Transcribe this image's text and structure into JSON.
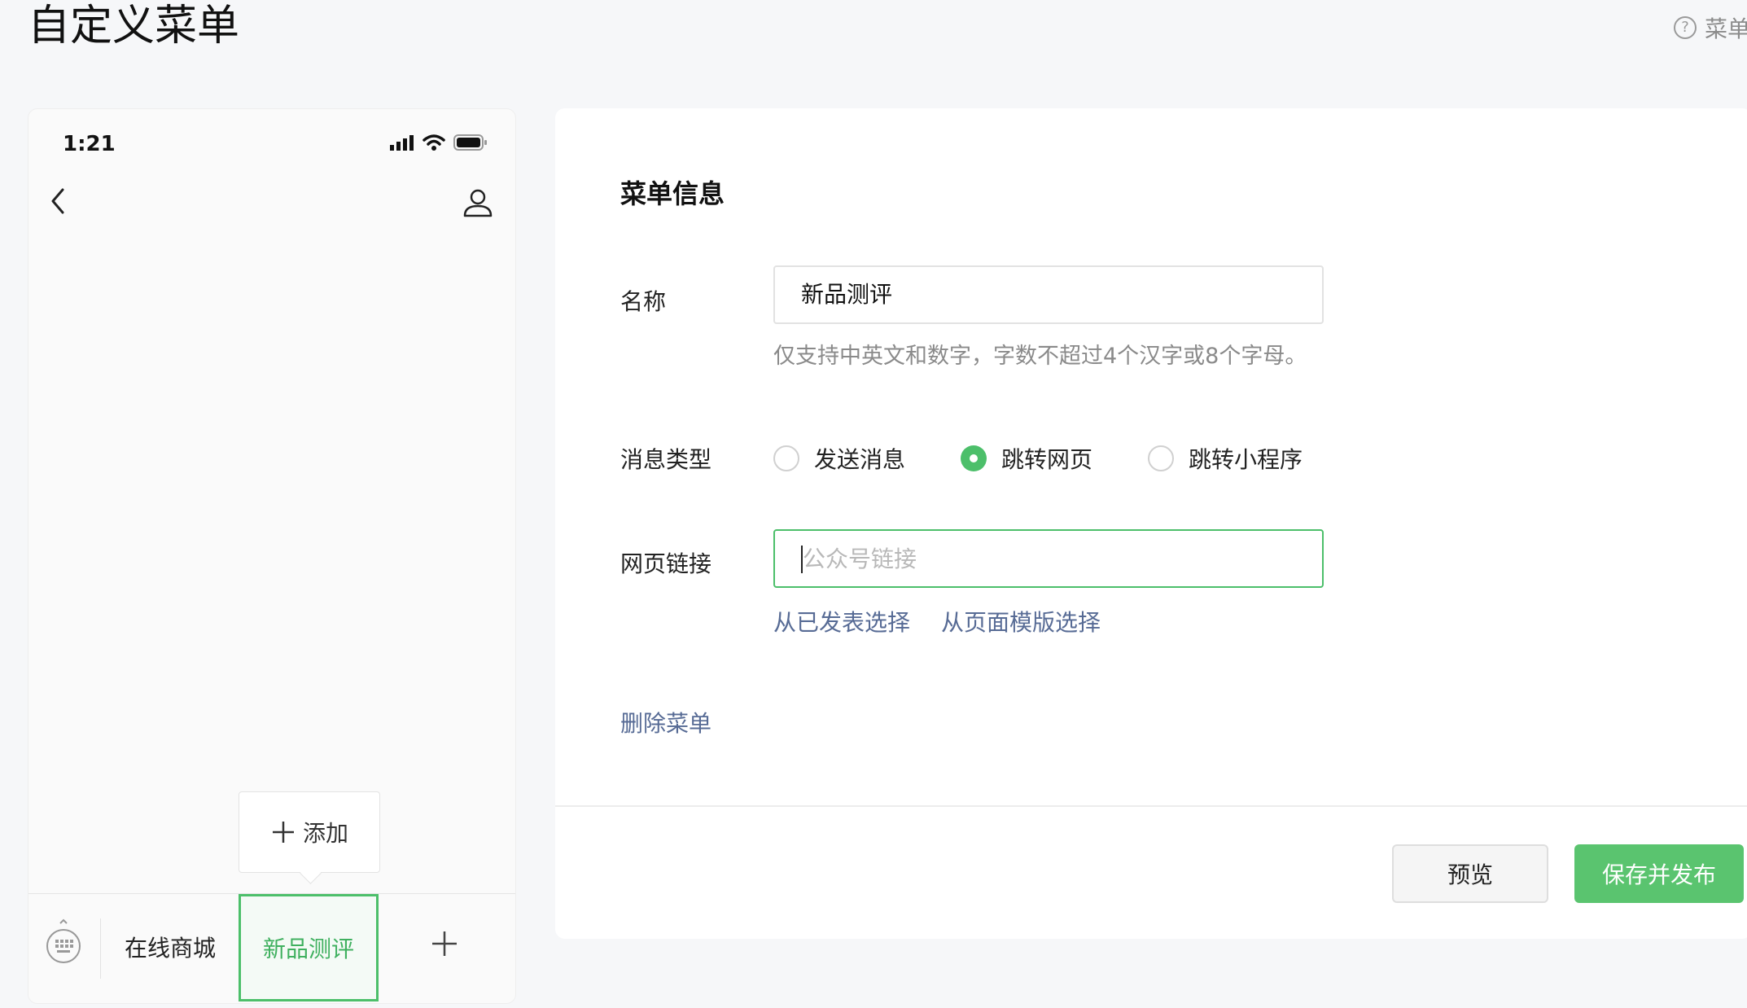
{
  "page": {
    "title": "自定义菜单",
    "help_label": "菜单",
    "help_icon": "question-circle-icon"
  },
  "phone": {
    "time": "1:21",
    "status_icons": [
      "signal-icon",
      "wifi-icon",
      "battery-icon"
    ],
    "add_popup_label": "添加",
    "menu_items": [
      {
        "label": "在线商城",
        "selected": false
      },
      {
        "label": "新品测评",
        "selected": true
      }
    ]
  },
  "form": {
    "section_title": "菜单信息",
    "name_label": "名称",
    "name_value": "新品测评",
    "name_hint": "仅支持中英文和数字，字数不超过4个汉字或8个字母。",
    "type_label": "消息类型",
    "type_options": [
      {
        "label": "发送消息",
        "checked": false
      },
      {
        "label": "跳转网页",
        "checked": true
      },
      {
        "label": "跳转小程序",
        "checked": false
      }
    ],
    "link_label": "网页链接",
    "link_value": "",
    "link_placeholder": "公众号链接",
    "select_published": "从已发表选择",
    "select_template": "从页面模版选择",
    "delete_menu": "删除菜单"
  },
  "actions": {
    "preview": "预览",
    "save_publish": "保存并发布"
  },
  "colors": {
    "accent_green": "#4cbf6a",
    "link_blue": "#576b95",
    "publish_button": "#5ac46f"
  }
}
